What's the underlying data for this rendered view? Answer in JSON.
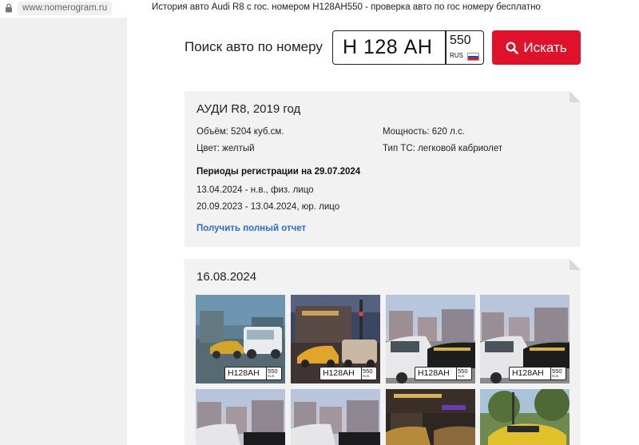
{
  "browser": {
    "url": "www.nomerogram.ru",
    "title": "История авто Audi R8 с гос. номером Н128АН550 - проверка авто по гос номеру бесплатно"
  },
  "search": {
    "label": "Поиск авто по номеру",
    "plate_number": "Н 128 АН",
    "plate_region": "550",
    "plate_country": "RUS",
    "button_label": "Искать",
    "button_color": "#e0112b"
  },
  "car": {
    "title": "АУДИ R8, 2019 год",
    "volume": "Объём: 5204 куб.см.",
    "power": "Мощность: 620 л.с.",
    "color": "Цвет: желтый",
    "type": "Тип ТС: легковой кабриолет",
    "registration_title": "Периоды регистрации на 29.07.2024",
    "registrations": [
      {
        "period": "13.04.2024",
        "detail": " - н.в., физ. лицо"
      },
      {
        "period": "20.09.2023 - 13.04.2024",
        "detail": ", юр. лицо"
      }
    ],
    "report_link": "Получить полный отчет",
    "link_color": "#2a6fc9"
  },
  "photos": {
    "date": "16.08.2024",
    "plate_number": "Н128АН",
    "plate_region": "550",
    "plate_country": "RUS"
  }
}
